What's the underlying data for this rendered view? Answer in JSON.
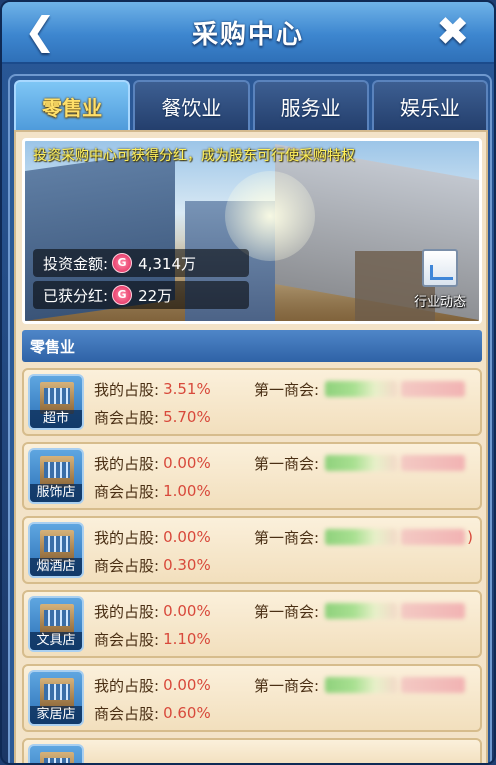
{
  "header": {
    "title": "采购中心",
    "back_glyph": "❮",
    "close_glyph": "✖"
  },
  "tabs": [
    {
      "label": "零售业",
      "active": true
    },
    {
      "label": "餐饮业",
      "active": false
    },
    {
      "label": "服务业",
      "active": false
    },
    {
      "label": "娱乐业",
      "active": false
    }
  ],
  "banner": {
    "text": "投资采购中心可获得分红，成为股东可行使采购特权",
    "invest_label": "投资金额:",
    "invest_value": "4,314万",
    "dividend_label": "已获分红:",
    "dividend_value": "22万",
    "coin_glyph": "G",
    "trend_label": "行业动态"
  },
  "section": {
    "title": "零售业"
  },
  "labels": {
    "my_share": "我的占股:",
    "guild_share": "商会占股:",
    "first_guild": "第一商会:",
    "paren_close": ")"
  },
  "rows": [
    {
      "name": "超市",
      "my_share": "3.51%",
      "guild_share": "5.70%"
    },
    {
      "name": "服饰店",
      "my_share": "0.00%",
      "guild_share": "1.00%"
    },
    {
      "name": "烟酒店",
      "my_share": "0.00%",
      "guild_share": "0.30%"
    },
    {
      "name": "文具店",
      "my_share": "0.00%",
      "guild_share": "1.10%"
    },
    {
      "name": "家居店",
      "my_share": "0.00%",
      "guild_share": "0.60%"
    }
  ],
  "colors": {
    "accent_value": "#d8493b",
    "active_tab_text": "#ffe06a",
    "banner_text": "#fff05a"
  }
}
